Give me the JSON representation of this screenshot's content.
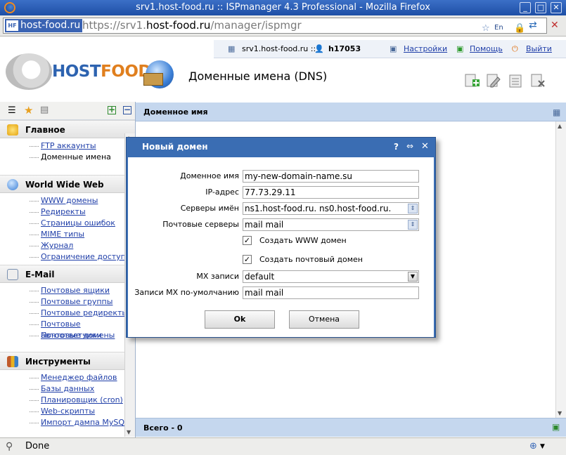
{
  "window": {
    "title": "srv1.host-food.ru :: ISPmanager 4.3 Professional - Mozilla Firefox",
    "minimize": "_",
    "maximize": "□",
    "close": "✕"
  },
  "urlbar": {
    "site_id": "host-food.ru",
    "url_scheme": "https://srv1.",
    "url_host": "host-food.ru",
    "url_path": "/manager/ispmgr",
    "lang": "En"
  },
  "header": {
    "server": "srv1.host-food.ru ::",
    "user": "h17053",
    "settings": "Настройки",
    "help": "Помощь",
    "logout": "Выйти",
    "brand_part1": "HOST",
    "brand_part2": "FOOD",
    "page_title": "Доменные имена (DNS)"
  },
  "sidebar": {
    "sections": [
      {
        "title": "Главное",
        "items": [
          "FTP аккаунты",
          "Доменные имена"
        ]
      },
      {
        "title": "World Wide Web",
        "items": [
          "WWW домены",
          "Редиректы",
          "Страницы ошибок",
          "MIME типы",
          "Журнал",
          "Ограничение доступа"
        ]
      },
      {
        "title": "E-Mail",
        "items": [
          "Почтовые ящики",
          "Почтовые группы",
          "Почтовые редиректы",
          "Почтовые автоответчики",
          "Почтовые домены"
        ]
      },
      {
        "title": "Инструменты",
        "items": [
          "Менеджер файлов",
          "Базы данных",
          "Планировщик (cron)",
          "Web-скрипты",
          "Импорт дампа MySQL"
        ]
      }
    ]
  },
  "main": {
    "column_header": "Доменное имя",
    "footer": "Всего - 0"
  },
  "dialog": {
    "title": "Новый домен",
    "help_icon": "?",
    "fields": {
      "domain_label": "Доменное имя",
      "domain_value": "my-new-domain-name.su",
      "ip_label": "IP-адрес",
      "ip_value": "77.73.29.11",
      "ns_label": "Серверы имён",
      "ns_value": "ns1.host-food.ru. ns0.host-food.ru.",
      "mail_label": "Почтовые серверы",
      "mail_value": "mail mail",
      "www_check_label": "Создать WWW домен",
      "mail_check_label": "Создать почтовый домен",
      "mx_label": "MX записи",
      "mx_value": "default",
      "mxdef_label": "Записи MX по-умолчанию",
      "mxdef_value": "mail mail"
    },
    "ok": "Ok",
    "cancel": "Отмена"
  },
  "status": {
    "text": "Done"
  }
}
